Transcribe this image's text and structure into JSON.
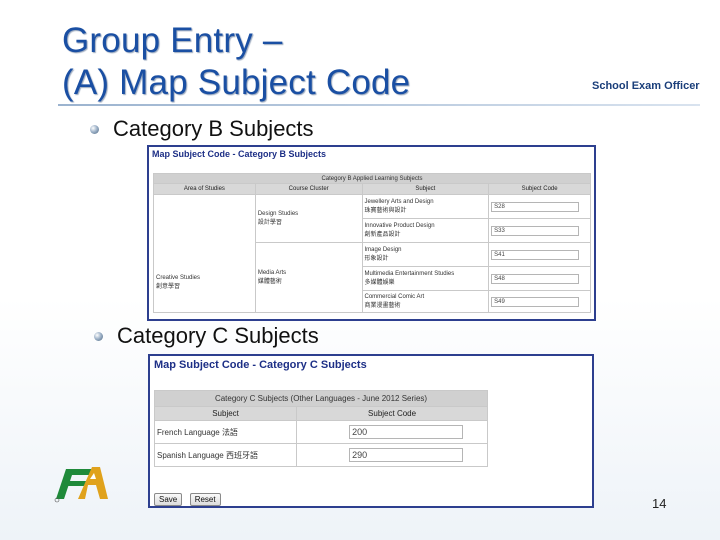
{
  "slide": {
    "title_line1": "Group Entry –",
    "title_line2": "(A) Map Subject Code",
    "role_label": "School Exam Officer",
    "bullet1": "Category B Subjects",
    "bullet2": "Category C Subjects",
    "page_number": "14"
  },
  "cat_b": {
    "panel_title": "Map Subject Code - Category B Subjects",
    "caption": "Category B Applied Learning Subjects",
    "headers": [
      "Area of Studies",
      "Course Cluster",
      "Subject",
      "Subject Code"
    ],
    "area": "Creative Studies\n創意學習",
    "clusters": [
      "Design Studies\n設計學習",
      "Media Arts\n媒體藝術"
    ],
    "rows": [
      {
        "subject": "Jewellery Arts and Design\n珠寶藝術與設計",
        "code": "S28"
      },
      {
        "subject": "Innovative Product Design\n創新產品設計",
        "code": "S33"
      },
      {
        "subject": "Image Design\n形象設計",
        "code": "S41"
      },
      {
        "subject": "Multimedia Entertainment Studies\n多媒體娛樂",
        "code": "S48"
      },
      {
        "subject": "Commercial Comic Art\n商業漫畫藝術",
        "code": "S49"
      }
    ]
  },
  "cat_c": {
    "panel_title": "Map Subject Code - Category C Subjects",
    "caption": "Category C Subjects (Other Languages - June 2012 Series)",
    "headers": [
      "Subject",
      "Subject Code"
    ],
    "rows": [
      {
        "subject": "French Language 法語",
        "code": "200"
      },
      {
        "subject": "Spanish Language 西班牙語",
        "code": "290"
      }
    ],
    "save_label": "Save",
    "reset_label": "Reset"
  },
  "colors": {
    "title": "#1a4fa3",
    "panel_border": "#2d3f8f",
    "panel_title": "#1d2f86"
  },
  "icons": [
    "bullet-sphere-icon",
    "hkeaa-logo-icon"
  ]
}
